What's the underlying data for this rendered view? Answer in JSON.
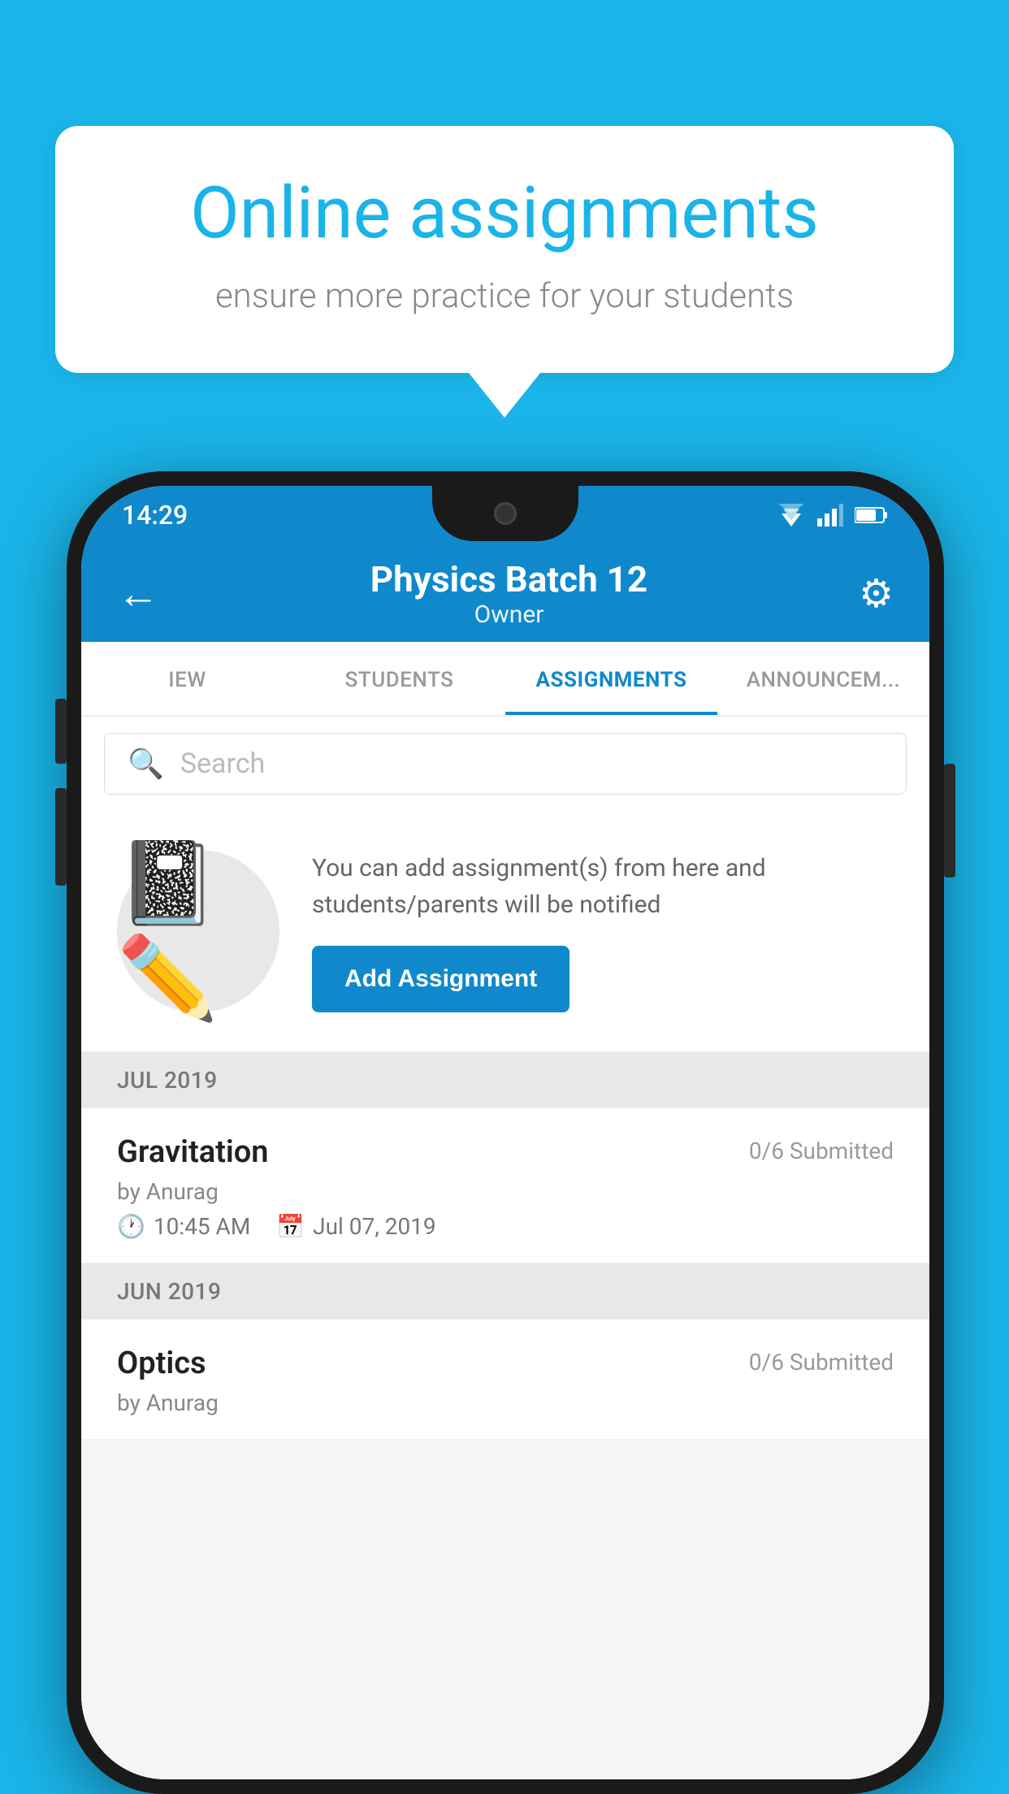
{
  "background_color": "#1ab4e8",
  "speech_bubble": {
    "title": "Online assignments",
    "subtitle": "ensure more practice for your students"
  },
  "phone": {
    "status_bar": {
      "time": "14:29"
    },
    "header": {
      "title": "Physics Batch 12",
      "subtitle": "Owner",
      "back_label": "←",
      "settings_label": "⚙"
    },
    "tabs": [
      {
        "label": "IEW",
        "active": false
      },
      {
        "label": "STUDENTS",
        "active": false
      },
      {
        "label": "ASSIGNMENTS",
        "active": true
      },
      {
        "label": "ANNOUNCEM...",
        "active": false
      }
    ],
    "search": {
      "placeholder": "Search"
    },
    "empty_state": {
      "description": "You can add assignment(s) from here and students/parents will be notified",
      "button_label": "Add Assignment"
    },
    "sections": [
      {
        "header": "JUL 2019",
        "assignments": [
          {
            "name": "Gravitation",
            "submitted": "0/6 Submitted",
            "author": "by Anurag",
            "time": "10:45 AM",
            "date": "Jul 07, 2019"
          }
        ]
      },
      {
        "header": "JUN 2019",
        "assignments": [
          {
            "name": "Optics",
            "submitted": "0/6 Submitted",
            "author": "by Anurag",
            "time": "",
            "date": ""
          }
        ]
      }
    ]
  }
}
